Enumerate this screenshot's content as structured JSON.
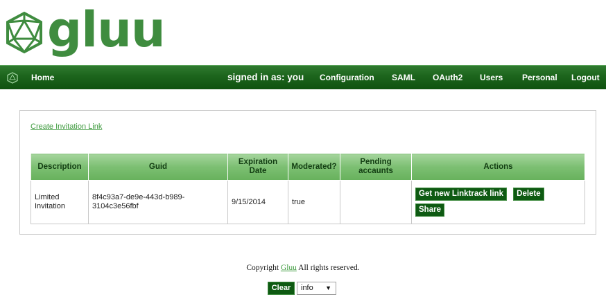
{
  "brand": {
    "logo_text": "gluu",
    "accent": "#3f8c3f",
    "nav_color": "#1c641c"
  },
  "nav": {
    "home": "Home",
    "signed_in": "signed in as: you",
    "items": [
      "Configuration",
      "SAML",
      "OAuth2",
      "Users",
      "Personal",
      "Logout"
    ]
  },
  "main": {
    "create_link": "Create Invitation Link",
    "table": {
      "headers": [
        "Description",
        "Guid",
        "Expiration Date",
        "Moderated?",
        "Pending accaunts",
        "Actions"
      ],
      "rows": [
        {
          "description": "Limited Invitation",
          "guid": "8f4c93a7-de9e-443d-b989-3104c3e56fbf",
          "expiration": "9/15/2014",
          "moderated": "true",
          "pending": "",
          "actions": [
            "Get new Linktrack link",
            "Delete",
            "Share"
          ]
        }
      ]
    }
  },
  "footer": {
    "copyright_prefix": "Copyright",
    "link": "Gluu",
    "copyright_suffix": "All rights reserved.",
    "clear_label": "Clear",
    "log_level": "info"
  }
}
